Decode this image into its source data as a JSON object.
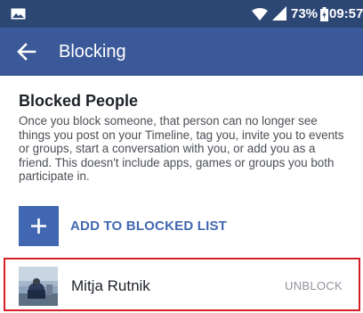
{
  "status_bar": {
    "battery_percent": "73%",
    "time": "09:57",
    "icons": [
      "gallery-icon",
      "wifi-icon",
      "signal-icon",
      "battery-icon"
    ]
  },
  "app_bar": {
    "title": "Blocking",
    "back_icon": "arrow-left-icon"
  },
  "blocked_people": {
    "title": "Blocked People",
    "description": "Once you block someone, that person can no longer see things you post on your Timeline, tag you, invite you to events or groups, start a conversation with you, or add you as a friend. This doesn't include apps, games or groups you both participate in.",
    "add_button_label": "ADD TO BLOCKED LIST",
    "add_icon": "plus-icon",
    "list": [
      {
        "name": "Mitja Rutnik",
        "action_label": "UNBLOCK"
      }
    ]
  },
  "colors": {
    "status_bar": "#2d4775",
    "app_bar": "#3b5998",
    "accent": "#4267b2",
    "highlight_border": "#d61f26"
  }
}
